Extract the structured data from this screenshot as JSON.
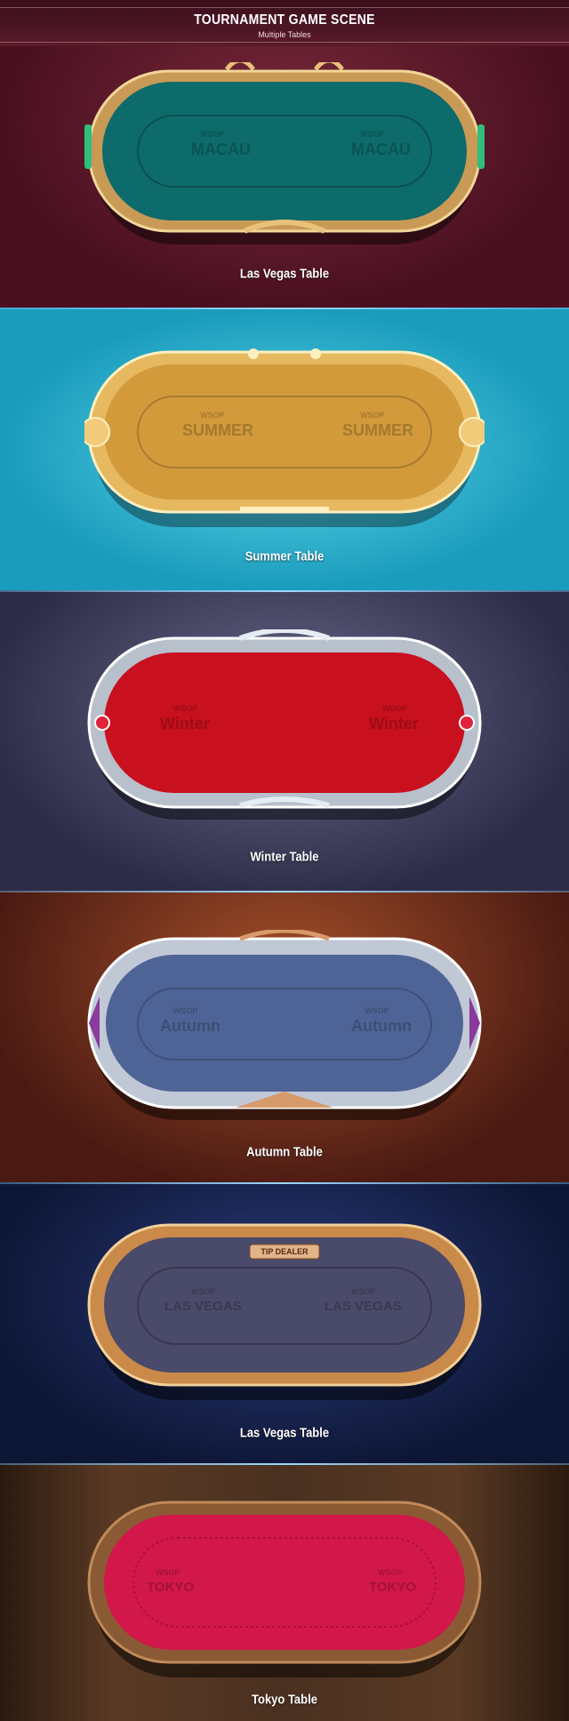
{
  "header": {
    "title": "TOURNAMENT GAME SCENE",
    "subtitle": "Multiple Tables"
  },
  "scenes": [
    {
      "caption": "Las Vegas Table",
      "felt_small": "WSOP",
      "felt_big": "MACAU",
      "felt_color": "#0e6b6b",
      "rim_color": "#c99a56",
      "bg": "#5a1a2a"
    },
    {
      "caption": "Summer Table",
      "felt_small": "WSOP",
      "felt_big": "SUMMER",
      "felt_color": "#d39a3c",
      "rim_color": "#e6b860",
      "bg": "#1fb0c8"
    },
    {
      "caption": "Winter Table",
      "felt_small": "WSOP",
      "felt_big": "Winter",
      "felt_color": "#c8101e",
      "rim_color": "#b8c0cc",
      "bg": "#3a3a5a"
    },
    {
      "caption": "Autumn Table",
      "felt_small": "WSOP",
      "felt_big": "Autumn",
      "felt_color": "#4f6496",
      "rim_color": "#c0c8d6",
      "bg": "#6a2a14"
    },
    {
      "caption": "Las Vegas Table",
      "felt_small": "WSOP",
      "felt_big": "LAS VEGAS",
      "felt_color": "#4a4a6a",
      "rim_color": "#c98a4a",
      "bg": "#141e46",
      "tip_label": "TIP DEALER"
    },
    {
      "caption": "Tokyo Table",
      "felt_small": "WSOP",
      "felt_big": "TOKYO",
      "felt_color": "#d2174a",
      "rim_color": "#8a5a34",
      "bg": "#3a2416"
    }
  ]
}
